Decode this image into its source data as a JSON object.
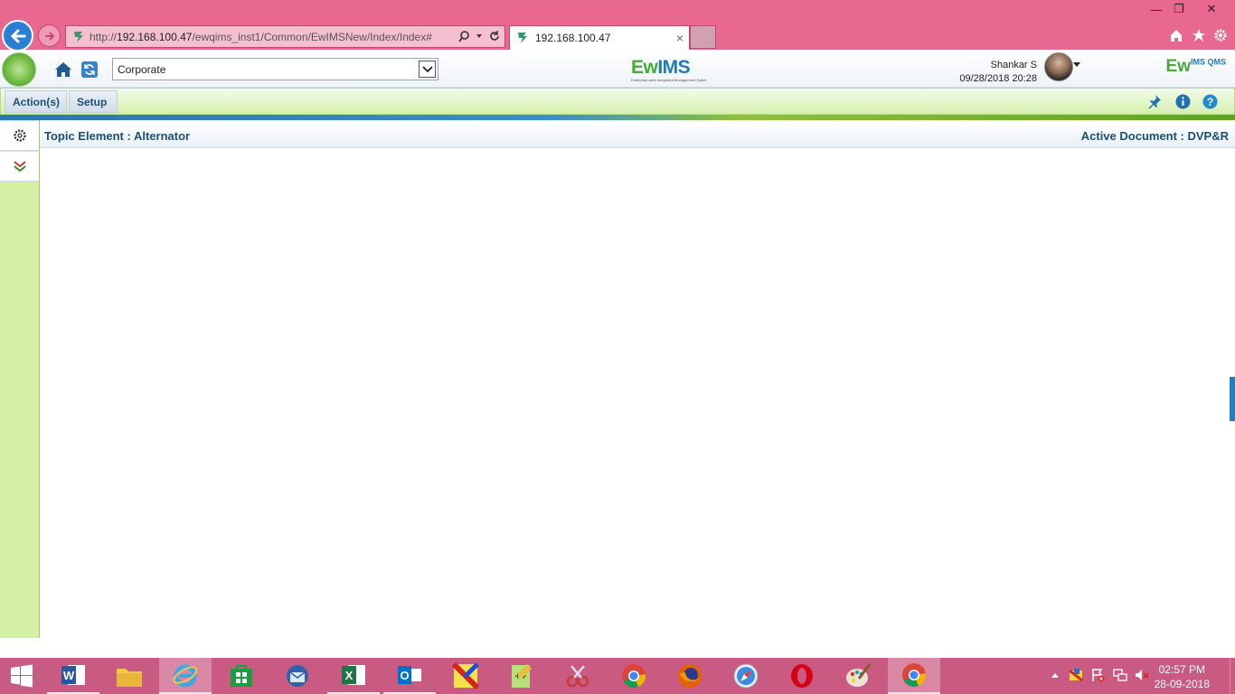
{
  "browser": {
    "url_prefix": "http://",
    "url_host": "192.168.100.47",
    "url_path": "/ewqims_inst1/Common/EwIMSNew/Index/Index#",
    "tab_title": "192.168.100.47",
    "tab_close": "×",
    "window_controls": {
      "minimize": "—",
      "restore": "❐",
      "close": "✕"
    }
  },
  "app": {
    "location_select": "Corporate",
    "brand": {
      "ew": "Ew",
      "ims": "IMS",
      "tagline": "Enterprise-wide Integrated Management System"
    },
    "brand2": {
      "main": "Ew",
      "sup": "IMS QMS"
    },
    "user": {
      "name": "Shankar S",
      "datetime": "09/28/2018 20:28"
    }
  },
  "menu": {
    "actions_label": "Action(s)",
    "setup_label": "Setup"
  },
  "panel": {
    "topic_element": "Topic Element : Alternator",
    "active_document": "Active Document : DVP&R"
  },
  "taskbar": {
    "apps": [
      "word",
      "file-explorer",
      "internet-explorer",
      "store",
      "thunderbird",
      "excel",
      "outlook",
      "paint-tool",
      "notepad-plus",
      "snipping-tool",
      "chrome",
      "firefox",
      "safari",
      "opera",
      "paint",
      "chrome"
    ],
    "time": "02:57 PM",
    "date": "28-09-2018"
  },
  "colors": {
    "chrome_pink": "#e8688f",
    "taskbar_pink": "#c95a82",
    "menu_green": "#d5f0ae",
    "title_blue": "#1b4f7a",
    "accent_blue": "#1f7ab8"
  }
}
